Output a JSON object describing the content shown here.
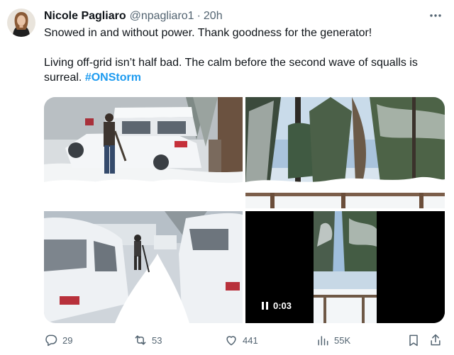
{
  "tweet": {
    "author_name": "Nicole Pagliaro",
    "handle": "@npagliaro1",
    "separator": "·",
    "time": "20h",
    "line1": "Snowed in and without power. Thank goodness for the generator!",
    "line2_text": "Living off-grid isn’t half bad. The calm before the second wave of squalls is surreal.",
    "hashtag": "#ONStorm",
    "more_icon": "more-horizontal-icon"
  },
  "media": {
    "video_time": "0:03",
    "pause_icon": "pause-icon"
  },
  "actions": {
    "replies": "29",
    "reposts": "53",
    "likes": "441",
    "views": "55K",
    "icons": [
      "reply-icon",
      "repost-icon",
      "like-icon",
      "views-icon",
      "bookmark-icon",
      "share-icon"
    ]
  },
  "colors": {
    "text": "#0f1419",
    "secondary": "#536471",
    "link": "#1d9bf0"
  }
}
